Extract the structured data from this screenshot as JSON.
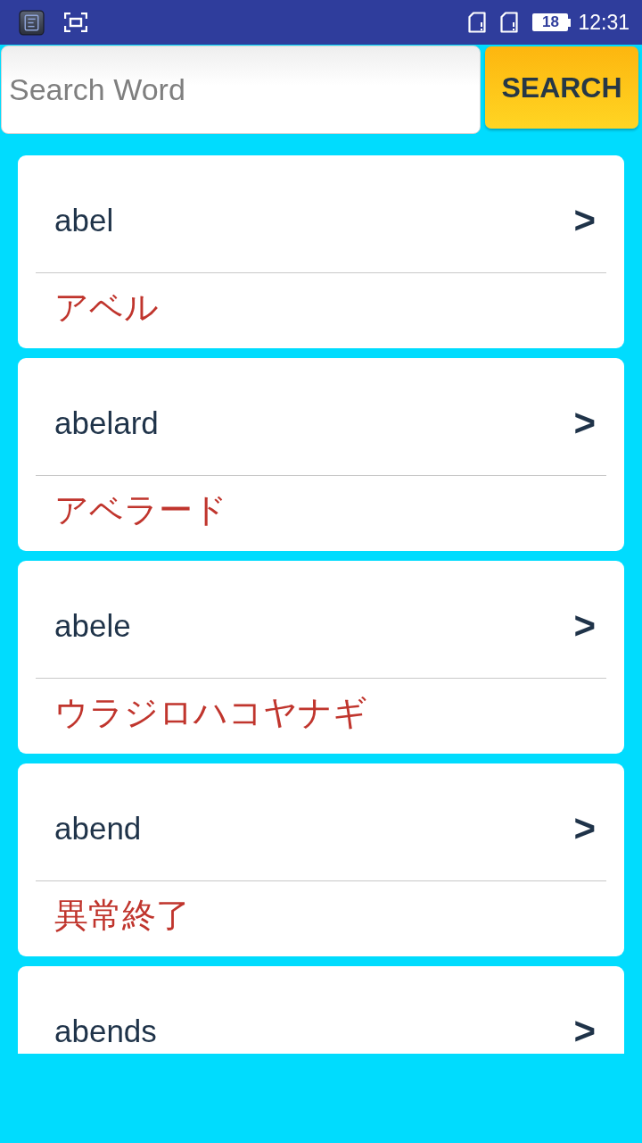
{
  "status_bar": {
    "battery": "18",
    "time": "12:31"
  },
  "search": {
    "placeholder": "Search Word",
    "button": "SEARCH"
  },
  "results": [
    {
      "word": "abel",
      "arrow": ">",
      "reading": "アベル"
    },
    {
      "word": "abelard",
      "arrow": ">",
      "reading": "アベラード"
    },
    {
      "word": "abele",
      "arrow": ">",
      "reading": "ウラジロハコヤナギ"
    },
    {
      "word": "abend",
      "arrow": ">",
      "reading": "異常終了"
    },
    {
      "word": "abends",
      "arrow": ">"
    }
  ]
}
